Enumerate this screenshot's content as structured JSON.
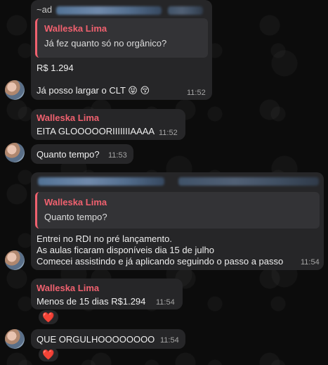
{
  "messages": [
    {
      "id": "m1",
      "forward_prefix": "~ad",
      "quote_sender": "Walleska Lima",
      "quote_text": "Já fez quanto só no orgânico?",
      "line1": "R$ 1.294",
      "line2": "Já posso largar o CLT 😝 😚",
      "time": "11:52"
    },
    {
      "id": "m2",
      "sender": "Walleska Lima",
      "text": "EITA GLOOOOORIIIIIIIAAAA",
      "time": "11:52"
    },
    {
      "id": "m3",
      "text": "Quanto tempo?",
      "time": "11:53"
    },
    {
      "id": "m4",
      "quote_sender": "Walleska Lima",
      "quote_text": "Quanto tempo?",
      "lines": [
        "Entrei no RDI no pré lançamento.",
        "As aulas ficaram disponíveis dia 15 de julho",
        "Comecei assistindo e já aplicando seguindo o passo a passo"
      ],
      "time": "11:54"
    },
    {
      "id": "m5",
      "sender": "Walleska Lima",
      "text": "Menos de 15 dias R$1.294",
      "time": "11:54",
      "reaction": "❤️"
    },
    {
      "id": "m6",
      "text": "QUE ORGULHOOOOOOOO",
      "time": "11:54",
      "reaction": "❤️"
    }
  ]
}
